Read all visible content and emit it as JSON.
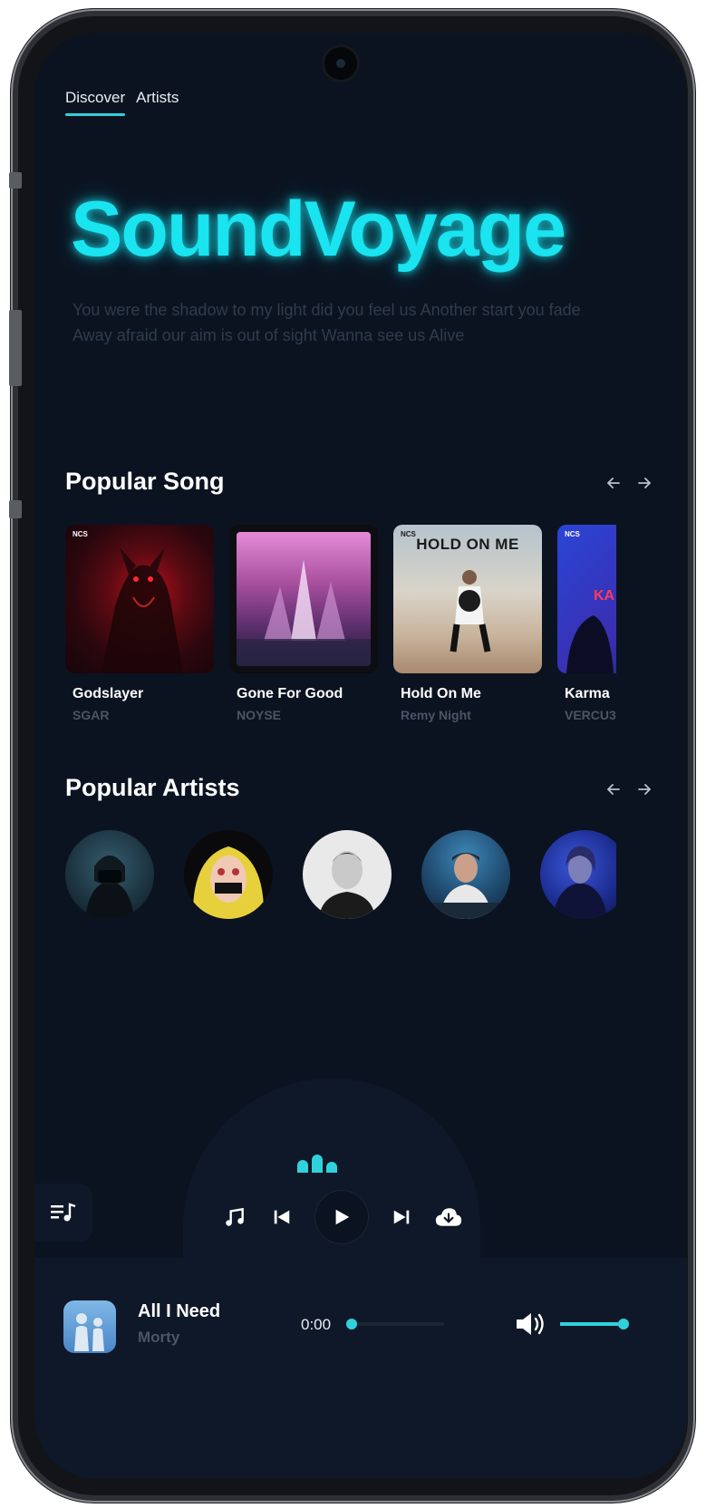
{
  "nav": {
    "tabs": [
      {
        "label": "Discover",
        "active": true
      },
      {
        "label": "Artists",
        "active": false
      }
    ]
  },
  "hero": {
    "title": "SoundVoyage",
    "lyrics": [
      "You were the shadow to my light did you feel us Another start you fade",
      "Away afraid our aim is out of sight Wanna see us Alive"
    ]
  },
  "popular_songs": {
    "title": "Popular Song",
    "items": [
      {
        "title": "Godslayer",
        "artist": "SGAR"
      },
      {
        "title": "Gone For Good",
        "artist": "NOYSE"
      },
      {
        "title": "Hold On Me",
        "artist": "Remy Night",
        "cover_text": "HOLD ON ME"
      },
      {
        "title": "Karma",
        "artist": "VERCU3"
      }
    ],
    "cover_badge": "NCS"
  },
  "popular_artists": {
    "title": "Popular Artists"
  },
  "player": {
    "now_playing_title": "All I Need",
    "now_playing_artist": "Morty",
    "time": "0:00",
    "progress": 0,
    "volume": 1
  },
  "colors": {
    "accent": "#2fd2dc",
    "background": "#0b1321",
    "panel": "#0f1828"
  }
}
